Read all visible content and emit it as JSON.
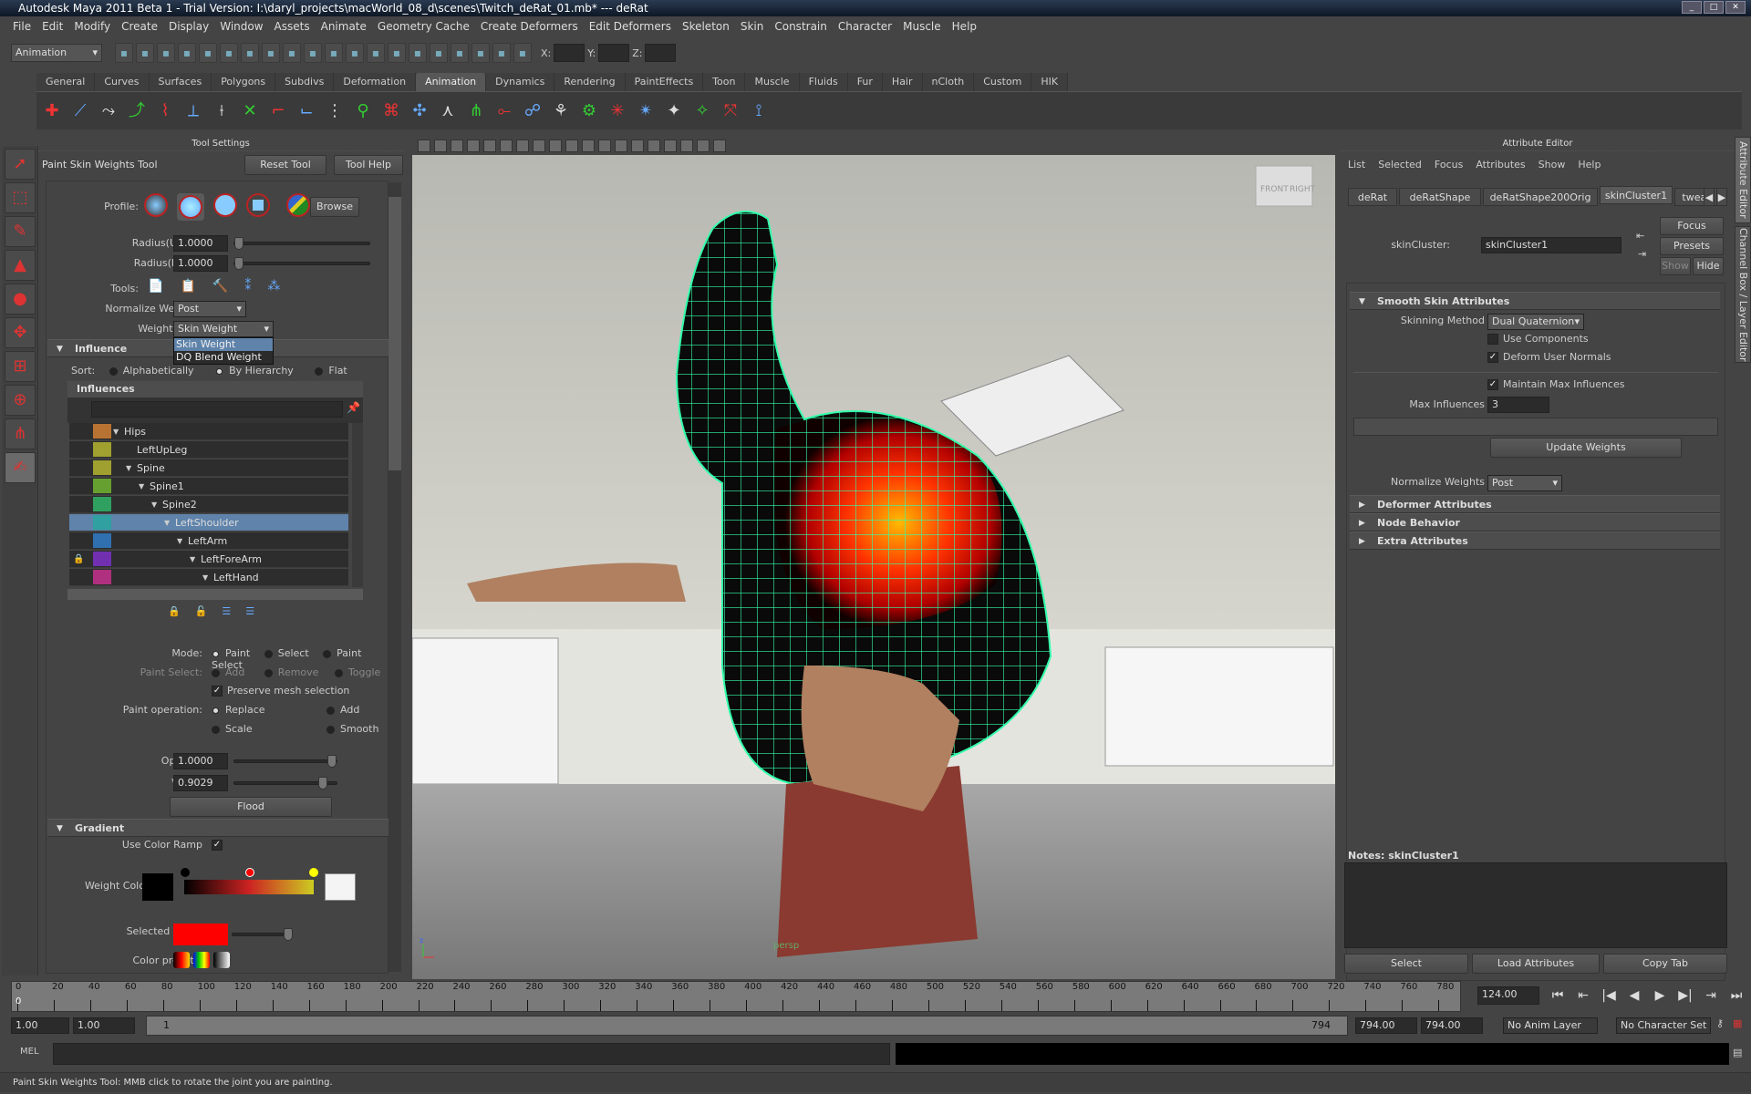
{
  "window": {
    "title": "Autodesk Maya 2011 Beta 1 - Trial Version: I:\\daryl_projects\\macWorld_08_d\\scenes\\Twitch_deRat_01.mb*  ---  deRat"
  },
  "menu": [
    "File",
    "Edit",
    "Modify",
    "Create",
    "Display",
    "Window",
    "Assets",
    "Animate",
    "Geometry Cache",
    "Create Deformers",
    "Edit Deformers",
    "Skeleton",
    "Skin",
    "Constrain",
    "Character",
    "Muscle",
    "Help"
  ],
  "statusline": {
    "mode": "Animation",
    "x_label": "X:",
    "y_label": "Y:",
    "z_label": "Z:",
    "icons": [
      "new-scene",
      "open-scene",
      "save-scene",
      "select-hierarchy",
      "select-object",
      "select-component",
      "lock",
      "snap-grid",
      "snap-curve",
      "snap-point",
      "snap-view",
      "snap-surface",
      "help",
      "construction-history",
      "render",
      "ipr-render",
      "render-settings",
      "hypershade",
      "uv-editor",
      "outliner"
    ]
  },
  "shelf": {
    "tabs": [
      "General",
      "Curves",
      "Surfaces",
      "Polygons",
      "Subdivs",
      "Deformation",
      "Animation",
      "Dynamics",
      "Rendering",
      "PaintEffects",
      "Toon",
      "Muscle",
      "Fluids",
      "Fur",
      "Hair",
      "nCloth",
      "Custom",
      "HIK"
    ],
    "active_tab": "Animation",
    "icons": [
      "set-key",
      "joint-tool",
      "ik-handle",
      "ik-spline",
      "insert-joint",
      "mirror-joint",
      "orient-joint",
      "remove-joint",
      "connect-joint",
      "disconnect-joint",
      "reroot-skeleton",
      "bind-skin",
      "interactive-bind",
      "detach-skin",
      "go-to-bind-pose",
      "paint-skin-weights",
      "mirror-skin-weights",
      "copy-skin-weights",
      "add-influence",
      "remove-influence",
      "point-constraint",
      "aim-constraint",
      "orient-constraint",
      "scale-constraint",
      "parent-constraint",
      "pole-vector"
    ]
  },
  "toolbox": {
    "tools": [
      "select-tool",
      "lasso-tool",
      "paint-select-tool",
      "move-tool",
      "rotate-tool",
      "scale-tool",
      "universal-manipulator",
      "soft-mod-tool",
      "show-manipulator",
      "paint-skin-weights-tool"
    ]
  },
  "tool_settings": {
    "panel_title": "Tool Settings",
    "tool_name": "Paint Skin Weights Tool",
    "reset_label": "Reset Tool",
    "help_label": "Tool Help",
    "profile_label": "Profile:",
    "browse_label": "Browse",
    "radius_u_label": "Radius(U):",
    "radius_u": "1.0000",
    "radius_l_label": "Radius(L):",
    "radius_l": "1.0000",
    "tools_label": "Tools:",
    "normalize_label": "Normalize Weights:",
    "normalize_value": "Post",
    "weight_type_label": "Weight Type:",
    "weight_type_value": "Skin Weight",
    "weight_type_options": [
      "Skin Weight",
      "DQ Blend Weight"
    ],
    "influence_section": "Influence",
    "sort_label": "Sort:",
    "sort_options": [
      "Alphabetically",
      "By Hierarchy",
      "Flat"
    ],
    "sort_selected": "By Hierarchy",
    "influences_header": "Influences",
    "influences": [
      {
        "name": "Hips",
        "color": "#b87333",
        "depth": 0,
        "expand": true
      },
      {
        "name": "LeftUpLeg",
        "color": "#a0a030",
        "depth": 1,
        "expand": false
      },
      {
        "name": "Spine",
        "color": "#a0a030",
        "depth": 1,
        "expand": true
      },
      {
        "name": "Spine1",
        "color": "#66a030",
        "depth": 2,
        "expand": true
      },
      {
        "name": "Spine2",
        "color": "#30a060",
        "depth": 3,
        "expand": true
      },
      {
        "name": "LeftShoulder",
        "color": "#30a0a0",
        "depth": 4,
        "expand": true,
        "selected": true
      },
      {
        "name": "LeftArm",
        "color": "#3070b0",
        "depth": 5,
        "expand": true
      },
      {
        "name": "LeftForeArm",
        "color": "#7030b0",
        "depth": 6,
        "expand": true,
        "locked": true
      },
      {
        "name": "LeftHand",
        "color": "#b03080",
        "depth": 7,
        "expand": true
      }
    ],
    "mode_label": "Mode:",
    "mode_options": [
      "Paint",
      "Select",
      "Paint Select"
    ],
    "mode_selected": "Paint",
    "paint_select_label": "Paint Select:",
    "paint_select_options": [
      "Add",
      "Remove",
      "Toggle"
    ],
    "preserve_label": "Preserve mesh selection",
    "preserve_checked": true,
    "paint_op_label": "Paint operation:",
    "paint_op_options": [
      "Replace",
      "Add",
      "Scale",
      "Smooth"
    ],
    "paint_op_selected": "Replace",
    "opacity_label": "Opacity:",
    "opacity": "1.0000",
    "value_label": "Value:",
    "value": "0.9029",
    "flood_label": "Flood",
    "gradient_section": "Gradient",
    "use_ramp_label": "Use Color Ramp",
    "use_ramp_checked": true,
    "weight_color_label": "Weight Color:",
    "selected_color_label": "Selected Color:",
    "selected_color": "#ff0000",
    "presets_label": "Color presets:"
  },
  "viewport": {
    "camera": "persp",
    "view_cube": [
      "FRONT",
      "RIGHT"
    ],
    "wire_color": "#33ffaa"
  },
  "attribute_editor": {
    "panel_title": "Attribute Editor",
    "menu": [
      "List",
      "Selected",
      "Focus",
      "Attributes",
      "Show",
      "Help"
    ],
    "tabs": [
      "deRat",
      "deRatShape",
      "deRatShape200Orig",
      "skinCluster1",
      "tweak"
    ],
    "active_tab": "skinCluster1",
    "node_label": "skinCluster:",
    "node_value": "skinCluster1",
    "focus_label": "Focus",
    "presets_label": "Presets",
    "show_label": "Show",
    "hide_label": "Hide",
    "smooth_section": "Smooth Skin Attributes",
    "skinning_method_label": "Skinning Method",
    "skinning_method": "Dual Quaternion",
    "use_components_label": "Use Components",
    "use_components": false,
    "deform_normals_label": "Deform User Normals",
    "deform_normals": true,
    "maintain_max_label": "Maintain Max Influences",
    "maintain_max": true,
    "max_influences_label": "Max Influences",
    "max_influences": "3",
    "update_weights_label": "Update Weights",
    "normalize_label": "Normalize Weights",
    "normalize_value": "Post",
    "collapsed_sections": [
      "Deformer Attributes",
      "Node Behavior",
      "Extra Attributes"
    ],
    "notes_label": "Notes:  skinCluster1",
    "select_label": "Select",
    "load_label": "Load Attributes",
    "copy_label": "Copy Tab"
  },
  "side_tabs": [
    "Attribute Editor",
    "Channel Box / Layer Editor"
  ],
  "timeline": {
    "ticks": [
      "0",
      "20",
      "40",
      "60",
      "80",
      "100",
      "120",
      "140",
      "160",
      "180",
      "200",
      "220",
      "240",
      "260",
      "280",
      "300",
      "320",
      "340",
      "360",
      "380",
      "400",
      "420",
      "440",
      "460",
      "480",
      "500",
      "520",
      "540",
      "560",
      "580",
      "600",
      "620",
      "640",
      "660",
      "680",
      "700",
      "720",
      "740",
      "760",
      "780"
    ],
    "current_frame_marker": "0",
    "current_time": "124.00",
    "range_start": "1.00",
    "playback_start": "1.00",
    "range_slider_start": "1",
    "range_slider_end": "794",
    "playback_end": "794.00",
    "range_end": "794.00",
    "anim_layer": "No Anim Layer",
    "character_set": "No Character Set",
    "playback_buttons": [
      "go-to-start",
      "step-back-key",
      "step-back-frame",
      "play-backward",
      "play-forward",
      "step-forward-frame",
      "step-forward-key",
      "go-to-end"
    ]
  },
  "command_line": {
    "label": "MEL",
    "value": ""
  },
  "help_line": "Paint Skin Weights Tool: MMB click to rotate the joint you are painting."
}
